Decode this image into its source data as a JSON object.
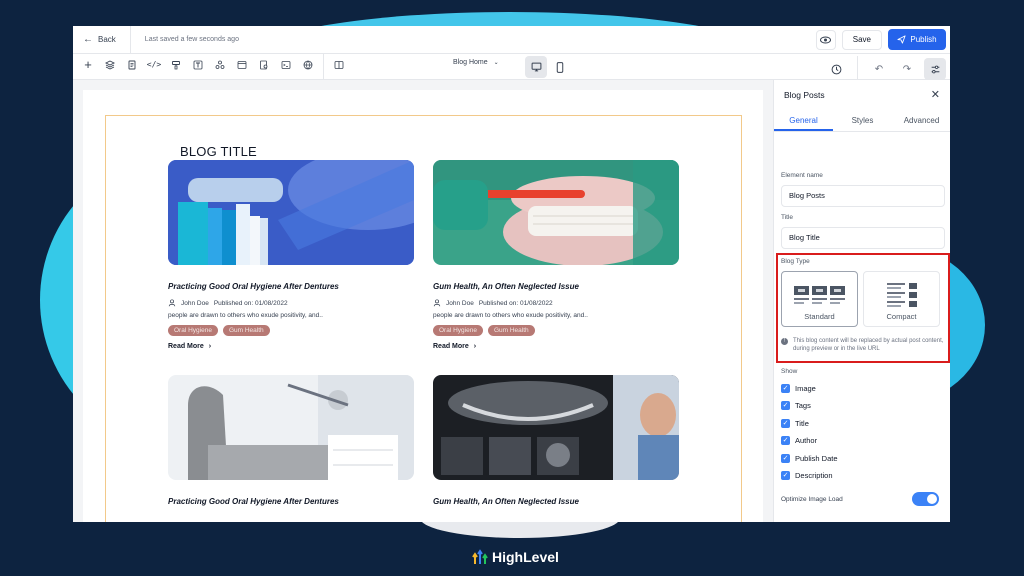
{
  "topbar": {
    "back_label": "Back",
    "saved_status": "Last saved a few seconds ago",
    "save_label": "Save",
    "publish_label": "Publish"
  },
  "toolbar": {
    "page_select": "Blog Home"
  },
  "canvas": {
    "blog_title": "BLOG TITLE",
    "posts": [
      {
        "title": "Practicing Good Oral Hygiene After Dentures",
        "author": "John Doe",
        "published": "Published on: 01/08/2022",
        "description": "people are drawn to others who exude positivity, and..",
        "tags": [
          "Oral Hygiene",
          "Gum Health"
        ],
        "read_more": "Read More"
      },
      {
        "title": "Gum Health, An Often Neglected Issue",
        "author": "John Doe",
        "published": "Published on: 01/08/2022",
        "description": "people are drawn to others who exude positivity, and..",
        "tags": [
          "Oral Hygiene",
          "Gum Health"
        ],
        "read_more": "Read More"
      },
      {
        "title": "Practicing Good Oral Hygiene After Dentures"
      },
      {
        "title": "Gum Health, An Often Neglected Issue"
      }
    ]
  },
  "panel": {
    "heading": "Blog Posts",
    "tabs": [
      "General",
      "Styles",
      "Advanced"
    ],
    "element_name_label": "Element name",
    "element_name_value": "Blog Posts",
    "title_label": "Title",
    "title_value": "Blog Title",
    "blog_type_label": "Blog Type",
    "blog_types": [
      "Standard",
      "Compact"
    ],
    "info_note": "This blog content will be replaced by actual post content, during preview or in the live URL",
    "show_label": "Show",
    "show_items": [
      "Image",
      "Tags",
      "Title",
      "Author",
      "Publish Date",
      "Description"
    ],
    "optimize_label": "Optimize Image Load"
  },
  "logo": {
    "text": "HighLevel"
  },
  "colors": {
    "accent": "#2563eb",
    "tag": "#b77974",
    "highlight": "#d91c1c",
    "background": "#0d2340"
  }
}
